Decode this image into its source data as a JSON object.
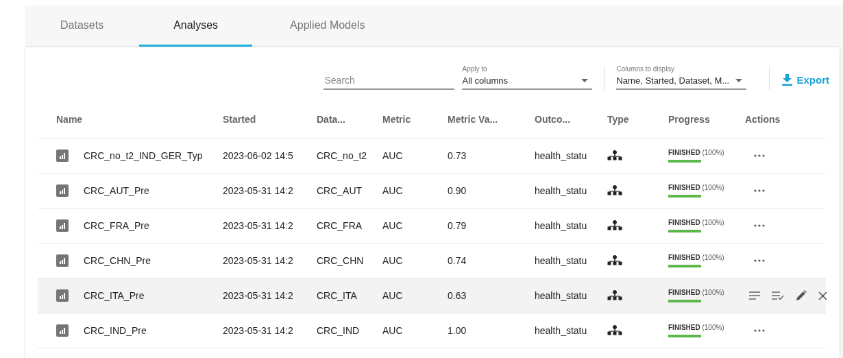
{
  "tabs": [
    {
      "label": "Datasets",
      "selected": false
    },
    {
      "label": "Analyses",
      "selected": true
    },
    {
      "label": "Applied Models",
      "selected": false
    }
  ],
  "toolbar": {
    "search": {
      "placeholder": "Search"
    },
    "apply_to": {
      "label": "Apply to",
      "value": "All columns"
    },
    "columns_to_display": {
      "label": "Columns to display",
      "value": "Name, Started, Dataset, M..."
    },
    "export": {
      "label": "Export"
    }
  },
  "table": {
    "columns": [
      "Name",
      "Started",
      "Data...",
      "Metric",
      "Metric Va...",
      "Outco...",
      "Type",
      "Progress",
      "Actions"
    ],
    "rows": [
      {
        "name": "CRC_no_t2_IND_GER_Typ",
        "started": "2023-06-02 14:5",
        "dataset": "CRC_no_t2",
        "metric": "AUC",
        "metric_value": "0.73",
        "outcome": "health_statu",
        "progress": {
          "text": "**FINISHED** (100%)",
          "level": 1
        },
        "hovered": false
      },
      {
        "name": "CRC_AUT_Pre",
        "started": "2023-05-31 14:2",
        "dataset": "CRC_AUT",
        "metric": "AUC",
        "metric_value": "0.90",
        "outcome": "health_statu",
        "progress": {
          "text": "**FINISHED** (100%)",
          "level": 1
        },
        "hovered": false
      },
      {
        "name": "CRC_FRA_Pre",
        "started": "2023-05-31 14:2",
        "dataset": "CRC_FRA",
        "metric": "AUC",
        "metric_value": "0.79",
        "outcome": "health_statu",
        "progress": {
          "text": "**FINISHED** (100%)",
          "level": 1
        },
        "hovered": false
      },
      {
        "name": "CRC_CHN_Pre",
        "started": "2023-05-31 14:2",
        "dataset": "CRC_CHN",
        "metric": "AUC",
        "metric_value": "0.74",
        "outcome": "health_statu",
        "progress": {
          "text": "**FINISHED** (100%)",
          "level": 1
        },
        "hovered": false
      },
      {
        "name": "CRC_ITA_Pre",
        "started": "2023-05-31 14:2",
        "dataset": "CRC_ITA",
        "metric": "AUC",
        "metric_value": "0.63",
        "outcome": "health_statu",
        "progress": {
          "text": "**FINISHED** (100%)",
          "level": 1
        },
        "hovered": true
      },
      {
        "name": "CRC_IND_Pre",
        "started": "2023-05-31 14:2",
        "dataset": "CRC_IND",
        "metric": "AUC",
        "metric_value": "1.00",
        "outcome": "health_statu",
        "progress": {
          "text": "**FINISHED** (100%)",
          "level": 1
        },
        "hovered": false
      }
    ]
  }
}
